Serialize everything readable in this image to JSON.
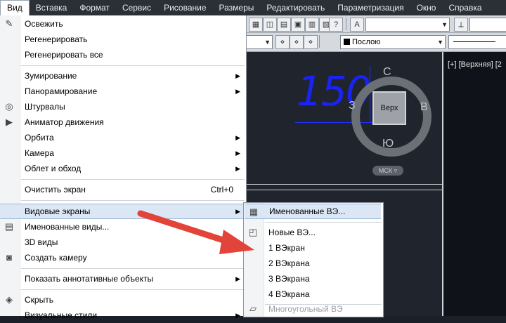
{
  "menubar": {
    "items": [
      "Вид",
      "Вставка",
      "Формат",
      "Сервис",
      "Рисование",
      "Размеры",
      "Редактировать",
      "Параметризация",
      "Окно",
      "Справка"
    ]
  },
  "toolbar": {
    "layer_combo_value": "Послою"
  },
  "viewport": {
    "label": "[+] [Верхняя] [2",
    "dimension_text": "150",
    "viewcube": {
      "top_face": "Верх",
      "north": "С",
      "south": "Ю",
      "west": "З",
      "east": "В",
      "ucs_label": "МСК"
    }
  },
  "view_menu": {
    "items": [
      {
        "label": "Освежить",
        "icon": "pencil-icon"
      },
      {
        "label": "Регенерировать"
      },
      {
        "label": "Регенерировать все"
      },
      {
        "label": "Зумирование",
        "submenu": true
      },
      {
        "label": "Панорамирование",
        "submenu": true
      },
      {
        "label": "Штурвалы",
        "icon": "steering-wheel-icon"
      },
      {
        "label": "Аниматор движения",
        "icon": "motion-animator-icon"
      },
      {
        "label": "Орбита",
        "submenu": true
      },
      {
        "label": "Камера",
        "submenu": true
      },
      {
        "label": "Облет и обход",
        "submenu": true
      },
      {
        "label": "Очистить экран",
        "shortcut": "Ctrl+0"
      },
      {
        "label": "Видовые экраны",
        "submenu": true,
        "highlighted": true
      },
      {
        "label": "Именованные виды...",
        "icon": "named-views-icon"
      },
      {
        "label": "3D виды",
        "submenu": true
      },
      {
        "label": "Создать камеру",
        "icon": "camera-icon"
      },
      {
        "label": "Показать аннотативные объекты",
        "submenu": true
      },
      {
        "label": "Скрыть",
        "icon": "hide-icon"
      },
      {
        "label": "Визуальные стили",
        "submenu": true
      }
    ]
  },
  "viewports_submenu": {
    "items": [
      {
        "label": "Именованные ВЭ...",
        "icon": "named-viewports-icon",
        "highlighted": true
      },
      {
        "label": "Новые ВЭ...",
        "icon": "new-viewports-icon"
      },
      {
        "label": "1 ВЭкран"
      },
      {
        "label": "2 ВЭкрана"
      },
      {
        "label": "3 ВЭкрана"
      },
      {
        "label": "4 ВЭкрана"
      },
      {
        "label": "Многоугольный ВЭ",
        "icon": "polygonal-viewport-icon",
        "disabled": true
      }
    ]
  },
  "colors": {
    "annotation_arrow": "#e2443a",
    "dimension_text": "#1a23f0",
    "menu_highlight": "#dbe7f5"
  }
}
